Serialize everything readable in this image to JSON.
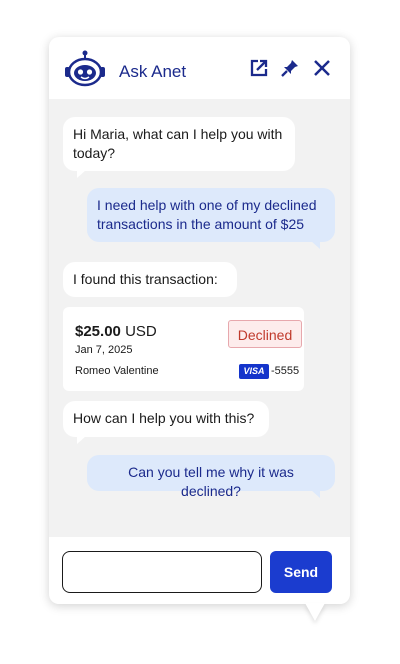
{
  "header": {
    "title": "Ask Anet",
    "logo_icon": "robot-icon",
    "actions": [
      {
        "icon": "open-external-icon"
      },
      {
        "icon": "pin-icon"
      },
      {
        "icon": "close-icon"
      }
    ]
  },
  "messages": [
    {
      "sender": "bot",
      "text": "Hi Maria, what can I help you with today?"
    },
    {
      "sender": "user",
      "text": "I need help with one of my declined transactions in the amount of $25"
    },
    {
      "sender": "bot",
      "text": "I found this transaction:"
    },
    {
      "sender": "bot",
      "text": "How can I help you with this?"
    },
    {
      "sender": "user",
      "text": "Can you tell me why it was declined?"
    }
  ],
  "transaction": {
    "amount": "$25.00",
    "currency": "USD",
    "date": "Jan 7, 2025",
    "merchant": "Romeo Valentine",
    "status": "Declined",
    "card_brand": "VISA",
    "card_last4": "-5555"
  },
  "composer": {
    "input_value": "",
    "placeholder": "",
    "send_label": "Send"
  },
  "colors": {
    "brand": "#1b2a8c",
    "send_button": "#1b3ccf",
    "user_bubble": "#dde9fb",
    "declined": "#c0392b",
    "visa": "#1434cb"
  }
}
